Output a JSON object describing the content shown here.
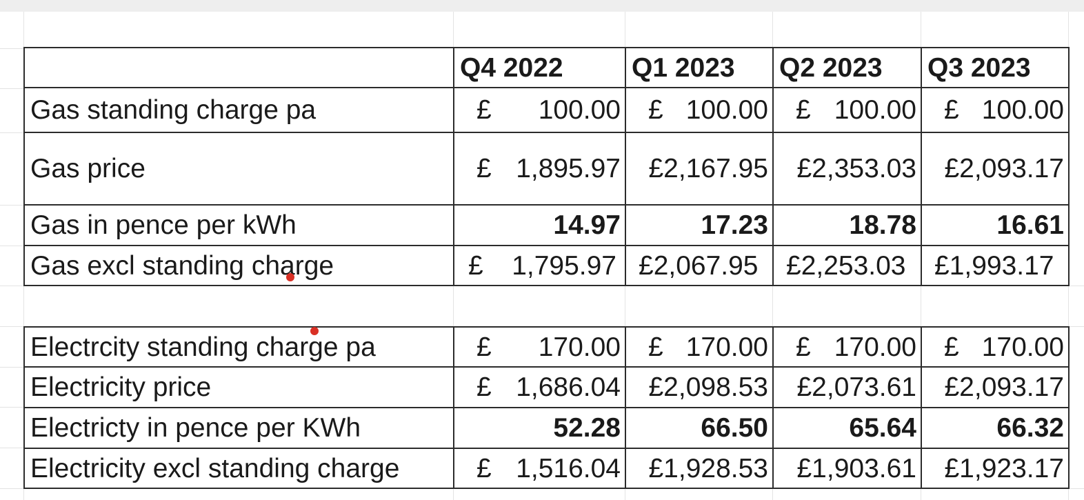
{
  "headers": [
    "Q4 2022",
    "Q1 2023",
    "Q2 2023",
    "Q3 2023"
  ],
  "gas_rows": [
    {
      "label": "Gas standing charge pa",
      "values": [
        "£|100.00",
        "£|100.00",
        "£|100.00",
        "£|100.00"
      ],
      "style": "currency"
    },
    {
      "label": "Gas price",
      "values": [
        "£|1,895.97",
        "£2,167.95",
        "£2,353.03",
        "£2,093.17"
      ],
      "style": "mixed"
    },
    {
      "label": "Gas in pence per kWh",
      "values": [
        "14.97",
        "17.23",
        "18.78",
        "16.61"
      ],
      "style": "bold"
    },
    {
      "label": "Gas excl standing charge",
      "values": [
        "£|1,795.97",
        "£2,067.95",
        "£2,253.03",
        "£1,993.17"
      ],
      "style": "mixed-left"
    }
  ],
  "elec_rows": [
    {
      "label": "Electrcity standing charge pa",
      "values": [
        "£|170.00",
        "£|170.00",
        "£|170.00",
        "£|170.00"
      ],
      "style": "currency"
    },
    {
      "label": "Electricity price",
      "values": [
        "£|1,686.04",
        "£2,098.53",
        "£2,073.61",
        "£2,093.17"
      ],
      "style": "mixed"
    },
    {
      "label": "Electricty in pence per KWh",
      "values": [
        "52.28",
        "66.50",
        "65.64",
        "66.32"
      ],
      "style": "bold"
    },
    {
      "label": "Electricity excl standing charge",
      "values": [
        "£|1,516.04",
        "£1,928.53",
        "£1,903.61",
        "£1,923.17"
      ],
      "style": "mixed"
    }
  ]
}
